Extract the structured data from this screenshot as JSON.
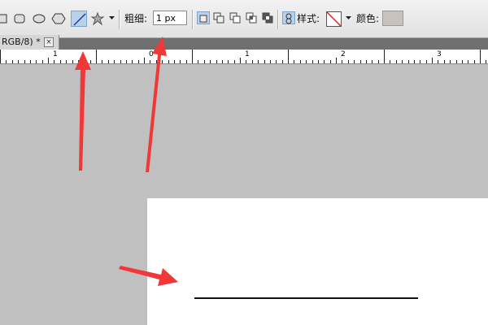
{
  "options_bar": {
    "weight_label": "粗细:",
    "weight_value": "1 px",
    "style_label": "样式:",
    "color_label": "颜色:",
    "tools": [
      "rectangle-tool",
      "rounded-rectangle-tool",
      "ellipse-tool",
      "polygon-tool",
      "line-tool",
      "custom-shape-tool"
    ],
    "selected_tool": "line-tool"
  },
  "document_tab": {
    "title": "RGB/8) *",
    "close_label": "×"
  },
  "ruler": {
    "labels": [
      "1",
      "0",
      "1",
      "2",
      "3"
    ]
  },
  "colors": {
    "workspace": "#c0c0c0",
    "annotation_arrow": "#f03838",
    "fill_color_swatch": "#c7c2bd"
  }
}
